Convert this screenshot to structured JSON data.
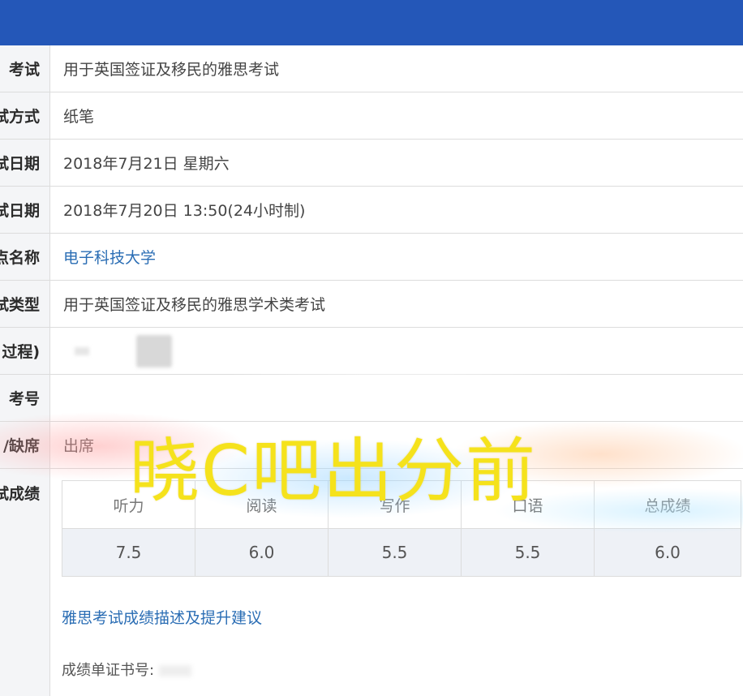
{
  "rows": [
    {
      "label": "考试",
      "value": "用于英国签证及移民的雅思考试"
    },
    {
      "label": "试方式",
      "value": "纸笔"
    },
    {
      "label": "试日期",
      "value": "2018年7月21日 星期六"
    },
    {
      "label": "试日期",
      "value": "2018年7月20日 13:50(24小时制)"
    },
    {
      "label": "点名称",
      "value": "电子科技大学"
    },
    {
      "label": "试类型",
      "value": "用于英国签证及移民的雅思学术类考试"
    },
    {
      "label": "过程)",
      "value": ""
    },
    {
      "label": "考号",
      "value": ""
    },
    {
      "label": "/缺席",
      "value": "出席"
    }
  ],
  "scores": {
    "label": "试成绩",
    "headers": [
      "听力",
      "阅读",
      "写作",
      "口语",
      "总成绩"
    ],
    "values": [
      "7.5",
      "6.0",
      "5.5",
      "5.5",
      "6.0"
    ]
  },
  "advice_link": "雅思考试成绩描述及提升建议",
  "certificate_label": "成绩单证书号:",
  "overlay_text": "晓C吧出分前",
  "colors": {
    "topbar": "#2457b8",
    "link": "#2a6db4",
    "overlay": "#f5e21c"
  }
}
